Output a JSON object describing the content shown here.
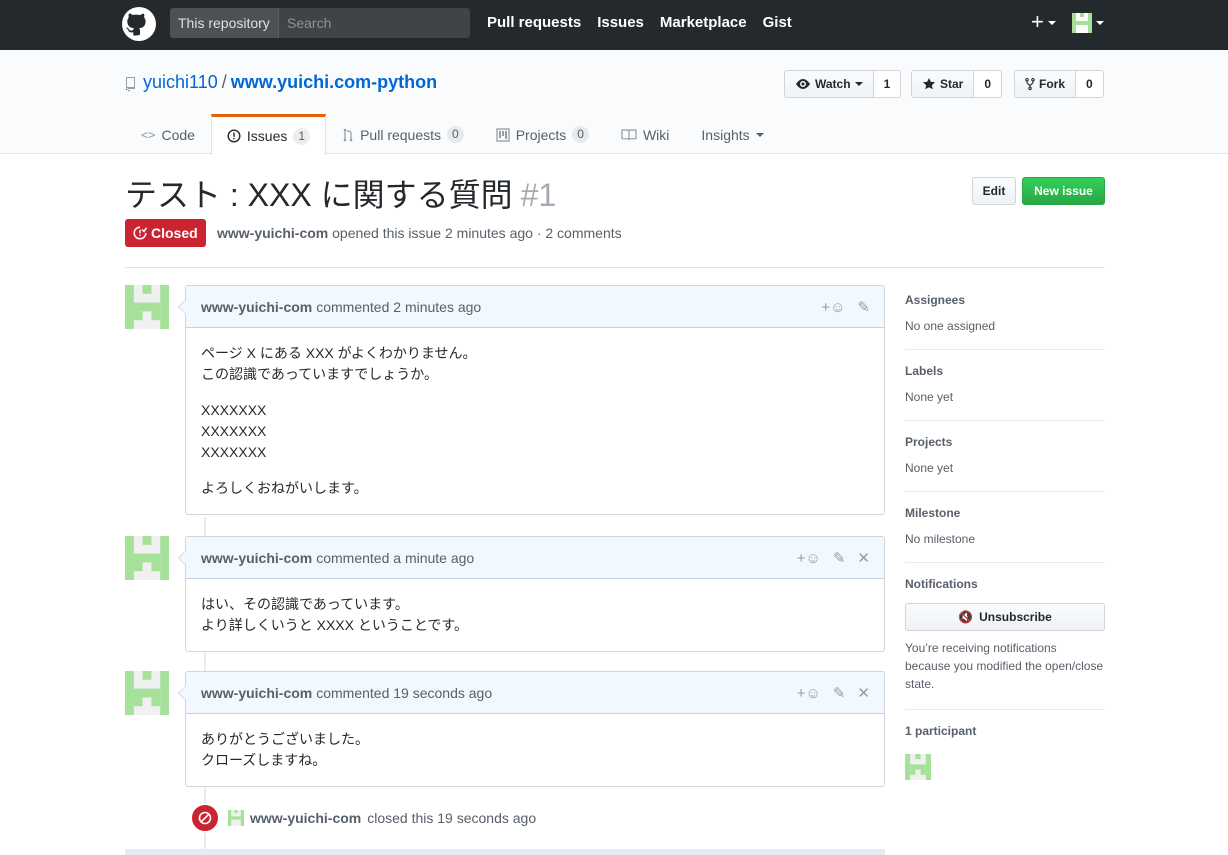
{
  "header": {
    "scope_label": "This repository",
    "search_placeholder": "Search",
    "nav": [
      "Pull requests",
      "Issues",
      "Marketplace",
      "Gist"
    ],
    "plus_label": "+"
  },
  "repo": {
    "owner": "yuichi110",
    "separator": "/",
    "name": "www.yuichi.com-python",
    "watch_label": "Watch",
    "watch_count": "1",
    "star_label": "Star",
    "star_count": "0",
    "fork_label": "Fork",
    "fork_count": "0"
  },
  "tabs": [
    {
      "label": "Code",
      "count": null
    },
    {
      "label": "Issues",
      "count": "1"
    },
    {
      "label": "Pull requests",
      "count": "0"
    },
    {
      "label": "Projects",
      "count": "0"
    },
    {
      "label": "Wiki",
      "count": null
    },
    {
      "label": "Insights",
      "count": null
    }
  ],
  "issue": {
    "title": "テスト : XXX に関する質問",
    "number": "#1",
    "state": "Closed",
    "author": "www-yuichi-com",
    "meta": "opened this issue 2 minutes ago · 2 comments",
    "edit_label": "Edit",
    "new_issue_label": "New issue"
  },
  "comments": [
    {
      "author": "www-yuichi-com",
      "time": "commented 2 minutes ago",
      "paragraphs": [
        [
          "ページ X にある XXX がよくわかりません。",
          "この認識であっていますでしょうか。"
        ],
        [
          "XXXXXXX",
          "XXXXXXX",
          "XXXXXXX"
        ],
        [
          "よろしくおねがいします。"
        ]
      ]
    },
    {
      "author": "www-yuichi-com",
      "time": "commented a minute ago",
      "paragraphs": [
        [
          "はい、その認識であっています。",
          "より詳しくいうと XXXX ということです。"
        ]
      ]
    },
    {
      "author": "www-yuichi-com",
      "time": "commented 19 seconds ago",
      "paragraphs": [
        [
          "ありがとうございました。",
          "クローズしますね。"
        ]
      ]
    }
  ],
  "closed_event": {
    "actor": "www-yuichi-com",
    "text": "closed this 19 seconds ago"
  },
  "sidebar": {
    "assignees_h": "Assignees",
    "assignees_v": "No one assigned",
    "labels_h": "Labels",
    "labels_v": "None yet",
    "projects_h": "Projects",
    "projects_v": "None yet",
    "milestone_h": "Milestone",
    "milestone_v": "No milestone",
    "notifications_h": "Notifications",
    "unsubscribe_label": "Unsubscribe",
    "notifications_note": "You’re receiving notifications because you modified the open/close state.",
    "participants_h": "1 participant"
  },
  "colors": {
    "closed": "#cb2431",
    "new_issue": "#28a745",
    "link": "#0366d6",
    "avatar_green": "#a6e19a"
  }
}
